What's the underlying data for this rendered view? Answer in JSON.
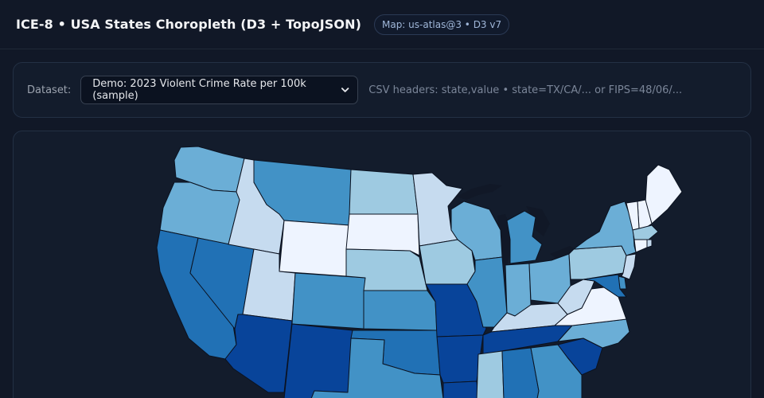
{
  "header": {
    "title": "ICE-8 • USA States Choropleth (D3 + TopoJSON)",
    "badge": "Map: us-atlas@3 • D3 v7"
  },
  "controls": {
    "dataset_label": "Dataset:",
    "dataset_selected": "Demo: 2023 Violent Crime Rate per 100k (sample)",
    "hint": "CSV headers: state,value • state=TX/CA/... or FIPS=48/06/..."
  },
  "map": {
    "colors": {
      "c0": "#eef4ff",
      "c1": "#c6dbef",
      "c2": "#9ecae1",
      "c3": "#6baed6",
      "c4": "#4292c6",
      "c5": "#2171b5",
      "c6": "#08449a"
    },
    "states": [
      {
        "id": "WA",
        "bin": 3
      },
      {
        "id": "OR",
        "bin": 3
      },
      {
        "id": "CA",
        "bin": 5
      },
      {
        "id": "NV",
        "bin": 5
      },
      {
        "id": "ID",
        "bin": 1
      },
      {
        "id": "MT",
        "bin": 4
      },
      {
        "id": "WY",
        "bin": 0
      },
      {
        "id": "UT",
        "bin": 1
      },
      {
        "id": "AZ",
        "bin": 6
      },
      {
        "id": "CO",
        "bin": 4
      },
      {
        "id": "NM",
        "bin": 6
      },
      {
        "id": "ND",
        "bin": 2
      },
      {
        "id": "SD",
        "bin": 0
      },
      {
        "id": "NE",
        "bin": 2
      },
      {
        "id": "KS",
        "bin": 4
      },
      {
        "id": "OK",
        "bin": 5
      },
      {
        "id": "TX",
        "bin": 4
      },
      {
        "id": "MN",
        "bin": 1
      },
      {
        "id": "IA",
        "bin": 2
      },
      {
        "id": "MO",
        "bin": 6
      },
      {
        "id": "AR",
        "bin": 6
      },
      {
        "id": "LA",
        "bin": 6
      },
      {
        "id": "WI",
        "bin": 3
      },
      {
        "id": "IL",
        "bin": 4
      },
      {
        "id": "MI",
        "bin": 4
      },
      {
        "id": "IN",
        "bin": 3
      },
      {
        "id": "OH",
        "bin": 3
      },
      {
        "id": "KY",
        "bin": 1
      },
      {
        "id": "TN",
        "bin": 6
      },
      {
        "id": "MS",
        "bin": 2
      },
      {
        "id": "AL",
        "bin": 5
      },
      {
        "id": "GA",
        "bin": 4
      },
      {
        "id": "SC",
        "bin": 6
      },
      {
        "id": "NC",
        "bin": 3
      },
      {
        "id": "VA",
        "bin": 0
      },
      {
        "id": "WV",
        "bin": 1
      },
      {
        "id": "PA",
        "bin": 2
      },
      {
        "id": "NY",
        "bin": 3
      },
      {
        "id": "NJ",
        "bin": 1
      },
      {
        "id": "DE",
        "bin": 4
      },
      {
        "id": "MD",
        "bin": 5
      },
      {
        "id": "ME",
        "bin": 0
      },
      {
        "id": "NH",
        "bin": 0
      },
      {
        "id": "VT",
        "bin": 0
      },
      {
        "id": "MA",
        "bin": 2
      },
      {
        "id": "CT",
        "bin": 0
      },
      {
        "id": "RI",
        "bin": 1
      }
    ]
  }
}
